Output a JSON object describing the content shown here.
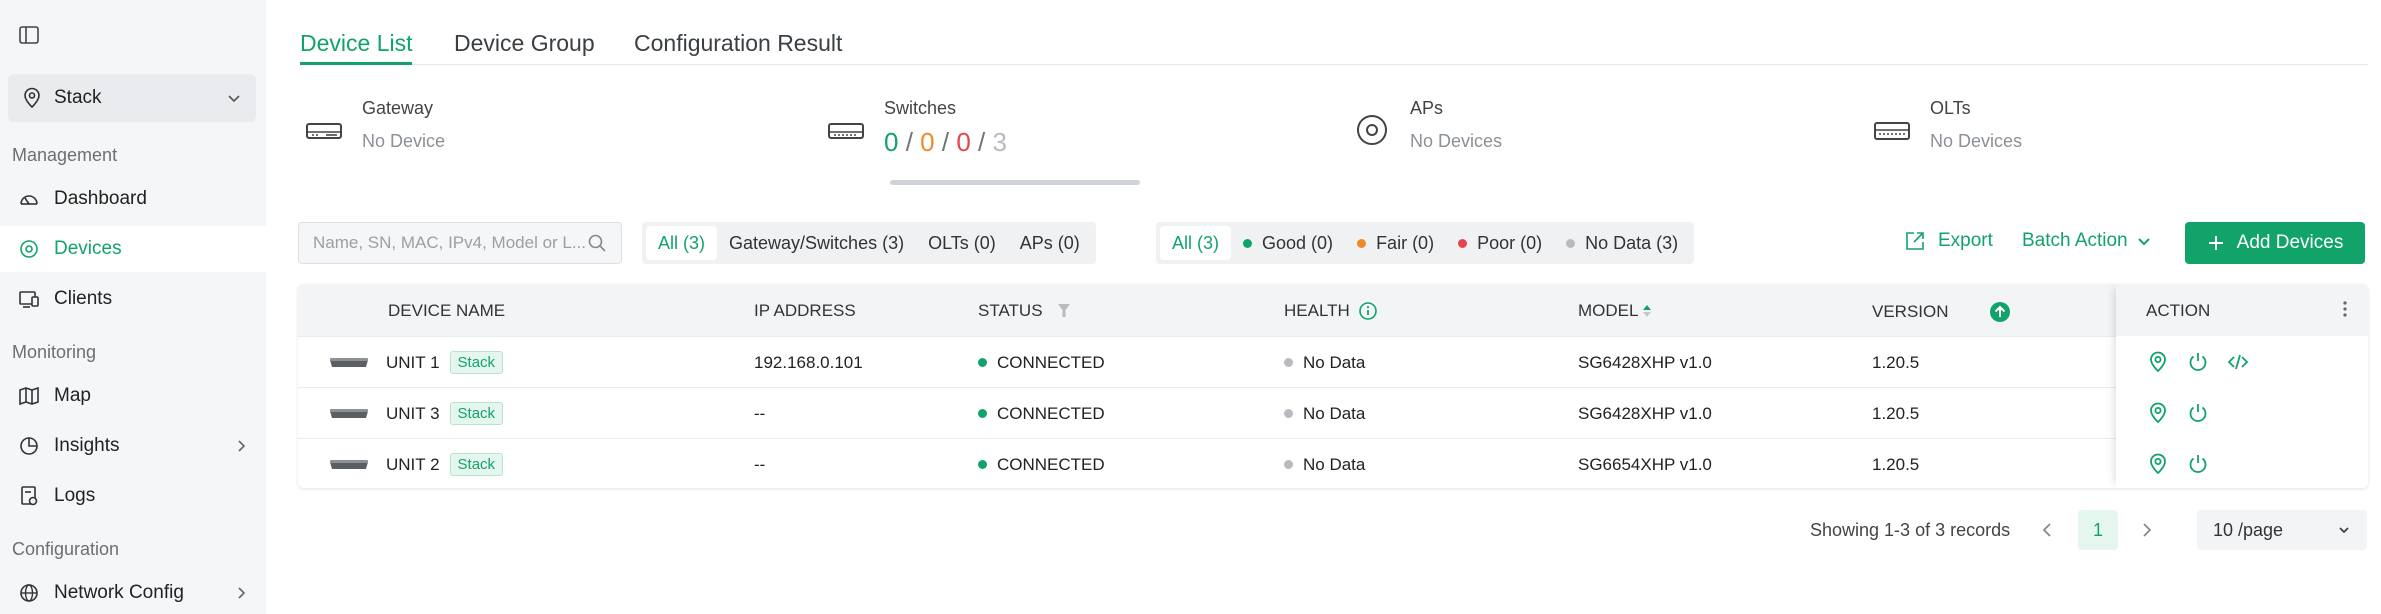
{
  "sidebar": {
    "site": "Stack",
    "sections": {
      "management": "Management",
      "monitoring": "Monitoring",
      "configuration": "Configuration"
    },
    "items": {
      "dashboard": "Dashboard",
      "devices": "Devices",
      "clients": "Clients",
      "map": "Map",
      "insights": "Insights",
      "logs": "Logs",
      "network_config": "Network Config"
    }
  },
  "tabs": {
    "device_list": "Device List",
    "device_group": "Device Group",
    "configuration_result": "Configuration Result"
  },
  "summary": {
    "gateway": {
      "title": "Gateway",
      "status": "No Device"
    },
    "switches": {
      "title": "Switches",
      "good": "0",
      "fair": "0",
      "poor": "0",
      "total": "3",
      "sep": "/"
    },
    "aps": {
      "title": "APs",
      "status": "No Devices"
    },
    "olts": {
      "title": "OLTs",
      "status": "No Devices"
    }
  },
  "filters": {
    "search_placeholder": "Name, SN, MAC, IPv4, Model or L...",
    "type": {
      "all": "All (3)",
      "gateway_switches": "Gateway/Switches (3)",
      "olts": "OLTs (0)",
      "aps": "APs (0)"
    },
    "health": {
      "all": "All (3)",
      "good": "Good (0)",
      "fair": "Fair (0)",
      "poor": "Poor (0)",
      "no_data": "No Data (3)"
    }
  },
  "actions": {
    "export": "Export",
    "batch_action": "Batch Action",
    "add_devices": "Add Devices"
  },
  "table": {
    "headers": {
      "device_name": "DEVICE NAME",
      "ip_address": "IP ADDRESS",
      "status": "STATUS",
      "health": "HEALTH",
      "model": "MODEL",
      "version": "VERSION",
      "action": "ACTION"
    },
    "rows": [
      {
        "name": "UNIT 1",
        "tag": "Stack",
        "ip": "192.168.0.101",
        "status": "CONNECTED",
        "health": "No Data",
        "model": "SG6428XHP v1.0",
        "version": "1.20.5"
      },
      {
        "name": "UNIT 3",
        "tag": "Stack",
        "ip": "--",
        "status": "CONNECTED",
        "health": "No Data",
        "model": "SG6428XHP v1.0",
        "version": "1.20.5"
      },
      {
        "name": "UNIT 2",
        "tag": "Stack",
        "ip": "--",
        "status": "CONNECTED",
        "health": "No Data",
        "model": "SG6654XHP v1.0",
        "version": "1.20.5"
      }
    ]
  },
  "pagination": {
    "showing": "Showing 1-3 of 3 records",
    "current_page": "1",
    "page_size": "10 /page"
  },
  "colors": {
    "accent": "#11a36a",
    "fair": "#f08a28",
    "poor": "#e6454d",
    "no_data": "#b7bbc0"
  }
}
